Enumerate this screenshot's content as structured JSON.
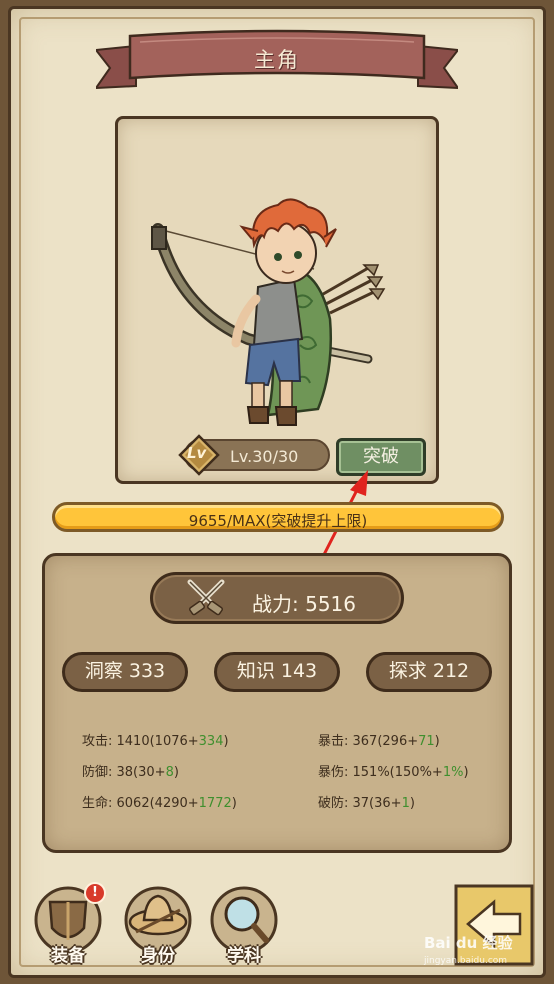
{
  "header": {
    "title": "主角"
  },
  "character": {
    "level_badge": "Lv",
    "level_text": "Lv.30/30",
    "break_button": "突破"
  },
  "experience": {
    "text": "9655/MAX(突破提升上限)",
    "fill": 1.0
  },
  "stats": {
    "power_label": "战力: 5516",
    "attributes": [
      {
        "label": "洞察 333"
      },
      {
        "label": "知识 143"
      },
      {
        "label": "探求 212"
      }
    ],
    "left": [
      {
        "prefix": "攻击: 1410(1076+",
        "bonus": "334",
        "suffix": ")"
      },
      {
        "prefix": "防御: 38(30+",
        "bonus": "8",
        "suffix": ")"
      },
      {
        "prefix": "生命: 6062(4290+",
        "bonus": "1772",
        "suffix": ")"
      }
    ],
    "right": [
      {
        "prefix": "暴击: 367(296+",
        "bonus": "71",
        "suffix": ")"
      },
      {
        "prefix": "暴伤: 151%(150%+",
        "bonus": "1%",
        "suffix": ")"
      },
      {
        "prefix": "破防: 37(36+",
        "bonus": "1",
        "suffix": ")"
      }
    ]
  },
  "nav": {
    "equipment": "装备",
    "identity": "身份",
    "discipline": "学科",
    "alert": "!"
  },
  "watermark": {
    "main": "Bai du 经验",
    "sub": "jingyan.baidu.com"
  },
  "colors": {
    "break_button": "#6f8f63",
    "exp_bar": "#ffc53a",
    "stat_bonus": "#3f8f2e",
    "banner": "#a3625b"
  }
}
